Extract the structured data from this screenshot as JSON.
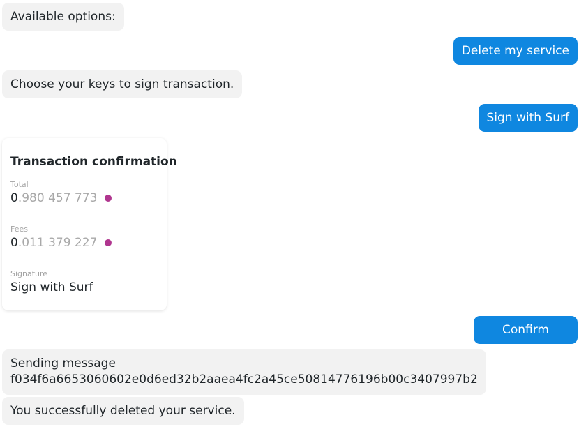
{
  "messages": {
    "available_options": "Available options:",
    "delete_service": "Delete my service",
    "choose_keys": "Choose your keys to sign transaction.",
    "sign_with_surf": "Sign with Surf",
    "confirm": "Confirm",
    "sending_line1": "Sending message",
    "sending_hash": "f034f6a6653060602e0d6ed32b2aaea4fc2a45ce50814776196b00c3407997b2",
    "success": "You successfully deleted your service."
  },
  "transaction": {
    "title": "Transaction confirmation",
    "total_label": "Total",
    "total_int": "0",
    "total_dec": ".980 457 773",
    "fees_label": "Fees",
    "fees_int": "0",
    "fees_dec": ".011 379 227",
    "signature_label": "Signature",
    "signature_value": "Sign with Surf",
    "token_icon": "token-dot-icon",
    "token_color": "#b0368f"
  },
  "colors": {
    "user_bubble": "#0f87e0",
    "bot_bubble": "#f2f2f2"
  }
}
